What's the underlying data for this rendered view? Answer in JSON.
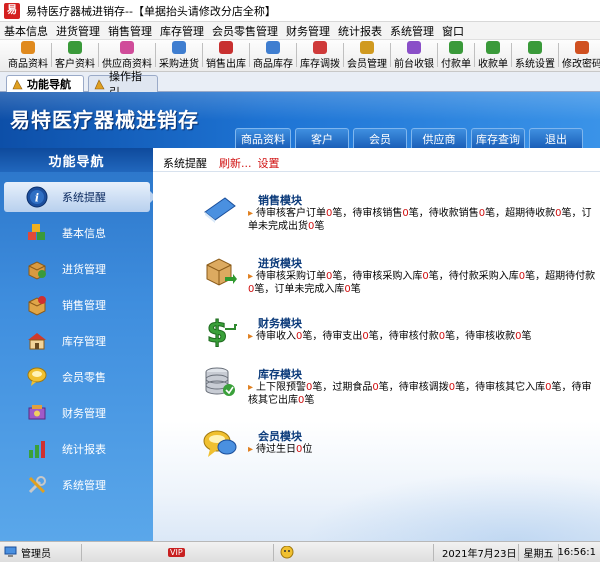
{
  "window": {
    "title": "易特医疗器械进销存--【单据抬头请修改分店全称】",
    "icon_text": "易"
  },
  "menubar": {
    "items": [
      "基本信息",
      "进货管理",
      "销售管理",
      "库存管理",
      "会员零售管理",
      "财务管理",
      "统计报表",
      "系统管理",
      "窗口"
    ]
  },
  "toolbar": {
    "items": [
      {
        "label": "商品资料",
        "icon": "product-icon",
        "color": "#e08a1e"
      },
      {
        "label": "客户资料",
        "icon": "customer-icon",
        "color": "#3a9a3a"
      },
      {
        "label": "供应商资料",
        "icon": "supplier-icon",
        "color": "#d04c9a"
      },
      {
        "label": "采购进货",
        "icon": "purchase-icon",
        "color": "#3f7ed0"
      },
      {
        "label": "销售出库",
        "icon": "sales-out-icon",
        "color": "#c83030"
      },
      {
        "label": "商品库存",
        "icon": "inventory-icon",
        "color": "#3f7ed0"
      },
      {
        "label": "库存调拨",
        "icon": "transfer-icon",
        "color": "#cf3a3a"
      },
      {
        "label": "会员管理",
        "icon": "member-icon",
        "color": "#d09a20"
      },
      {
        "label": "前台收银",
        "icon": "cashier-icon",
        "color": "#8a4fc8"
      },
      {
        "label": "付款单",
        "icon": "payment-icon",
        "color": "#3a9a3a"
      },
      {
        "label": "收款单",
        "icon": "receipt-icon",
        "color": "#3a9a3a"
      },
      {
        "label": "系统设置",
        "icon": "settings-icon",
        "color": "#3a9a3a"
      },
      {
        "label": "修改密码",
        "icon": "password-icon",
        "color": "#d05020"
      }
    ]
  },
  "tabs": [
    {
      "label": "功能导航",
      "active": true
    },
    {
      "label": "操作指引",
      "active": false
    }
  ],
  "banner": {
    "title": "易特医疗器械进销存",
    "nav": [
      "商品资料",
      "客户",
      "会员",
      "供应商",
      "库存查询",
      "退出"
    ]
  },
  "sidebar": {
    "header": "功能导航",
    "items": [
      {
        "label": "系统提醒",
        "icon": "info-icon",
        "active": true
      },
      {
        "label": "基本信息",
        "icon": "cubes-icon",
        "active": false
      },
      {
        "label": "进货管理",
        "icon": "purchase-box-icon",
        "active": false
      },
      {
        "label": "销售管理",
        "icon": "sales-box-icon",
        "active": false
      },
      {
        "label": "库存管理",
        "icon": "warehouse-icon",
        "active": false
      },
      {
        "label": "会员零售",
        "icon": "members-icon",
        "active": false
      },
      {
        "label": "财务管理",
        "icon": "finance-icon",
        "active": false
      },
      {
        "label": "统计报表",
        "icon": "bar-chart-icon",
        "active": false
      },
      {
        "label": "系统管理",
        "icon": "tools-icon",
        "active": false
      }
    ]
  },
  "content": {
    "breadcrumb": {
      "title": "系统提醒",
      "refresh": "刷新...",
      "settings": "设置"
    },
    "modules": [
      {
        "title": "销售模块",
        "icon": "sales-book-icon",
        "text": [
          "待审核客户订单",
          "0",
          "笔，待审核销售",
          "0",
          "笔，待收款销售",
          "0",
          "笔，超期待收款",
          "0",
          "笔，订单未",
          "完成出货",
          "0",
          "笔"
        ]
      },
      {
        "title": "进货模块",
        "icon": "purchase-module-icon",
        "text": [
          "待审核采购订单",
          "0",
          "笔，待审核采购入库",
          "0",
          "笔，待付款采购入库",
          "0",
          "笔，超期待付款",
          "0",
          "笔，订单未完成入库",
          "0",
          "笔"
        ]
      },
      {
        "title": "财务模块",
        "icon": "dollar-icon",
        "text": [
          "待审收入",
          "0",
          "笔，待审支出",
          "0",
          "笔，待审核付款",
          "0",
          "笔，待审核收款",
          "0",
          "笔"
        ]
      },
      {
        "title": "库存模块",
        "icon": "database-icon",
        "text": [
          "上下限预警",
          "0",
          "笔，过期食品",
          "0",
          "笔，待审核调拨",
          "0",
          "笔，待审核其它入库",
          "0",
          "笔，待审核",
          "其它出库",
          "0",
          "笔"
        ]
      },
      {
        "title": "会员模块",
        "icon": "chat-icon",
        "text": [
          "待过生日",
          "0",
          "位"
        ]
      }
    ]
  },
  "statusbar": {
    "user": "管理员",
    "vip": "VIP",
    "date": "2021年7月23日",
    "weekday": "星期五",
    "time": "16:56:1"
  },
  "colors": {
    "banner": "#1e74d4",
    "sidebar": "#3f8ede",
    "highlight_number": "#d01010",
    "module_title": "#0b3a7a"
  }
}
